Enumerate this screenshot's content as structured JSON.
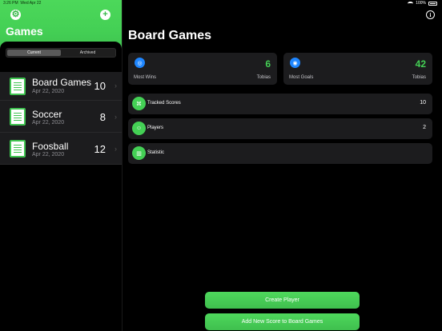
{
  "status": {
    "time": "3:26 PM",
    "date": "Wed Apr 22",
    "battery": "100%"
  },
  "sidebar": {
    "title": "Games",
    "segments": [
      "Current",
      "Archived"
    ],
    "games": [
      {
        "name": "Board Games",
        "date": "Apr 22, 2020",
        "count": "10"
      },
      {
        "name": "Soccer",
        "date": "Apr 22, 2020",
        "count": "8"
      },
      {
        "name": "Foosball",
        "date": "Apr 22, 2020",
        "count": "12"
      }
    ]
  },
  "main": {
    "title": "Board Games",
    "stats": [
      {
        "label": "Most Wins",
        "value": "6",
        "holder": "Tobias"
      },
      {
        "label": "Most Goals",
        "value": "42",
        "holder": "Tobias"
      }
    ],
    "menu": [
      {
        "label": "Tracked Scores",
        "count": "10"
      },
      {
        "label": "Players",
        "count": "2"
      },
      {
        "label": "Statistic",
        "count": ""
      }
    ],
    "buttons": {
      "create_player": "Create Player",
      "add_score": "Add New Score to Board Games"
    }
  },
  "colors": {
    "accent": "#44d055",
    "blue": "#1e86ff",
    "card": "#1c1c1e"
  },
  "icons": {
    "settings": "gear-icon",
    "add": "plus-icon",
    "info": "info-icon",
    "game": "document-icon",
    "wins": "medal-icon",
    "goals": "target-icon",
    "scores": "gamepad-icon",
    "players": "people-icon",
    "statistic": "chart-icon"
  }
}
